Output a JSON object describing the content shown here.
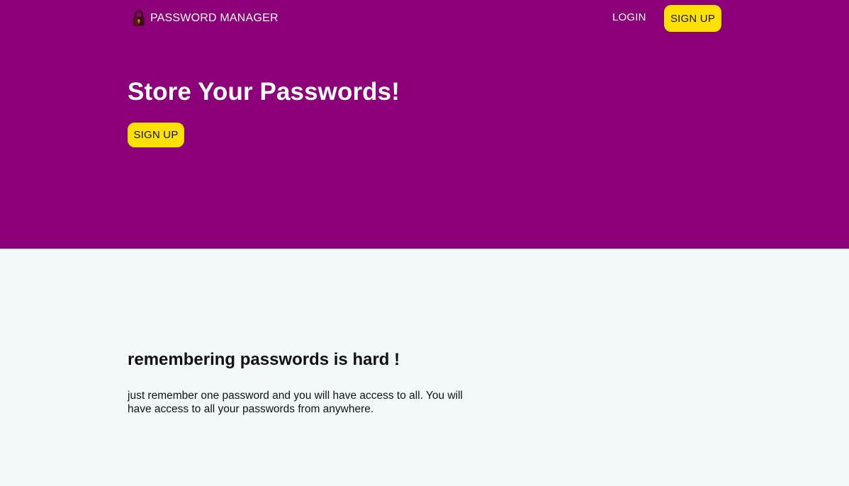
{
  "colors": {
    "hero_background": "#8b0079",
    "content_background": "#f3f8fb",
    "button_yellow": "#ffe100",
    "text_light": "#ffffff",
    "text_dark": "#111111"
  },
  "nav": {
    "brand_icon": "padlock-icon",
    "brand_label": "PASSWORD MANAGER",
    "login_label": "LOGIN",
    "signup_label": "SIGN UP"
  },
  "hero": {
    "title": "Store Your Passwords!",
    "signup_label": "SIGN UP"
  },
  "content": {
    "heading": "remembering passwords is hard !",
    "text": "just remember one password and you will have access to all. You will have access to all your passwords from anywhere."
  }
}
